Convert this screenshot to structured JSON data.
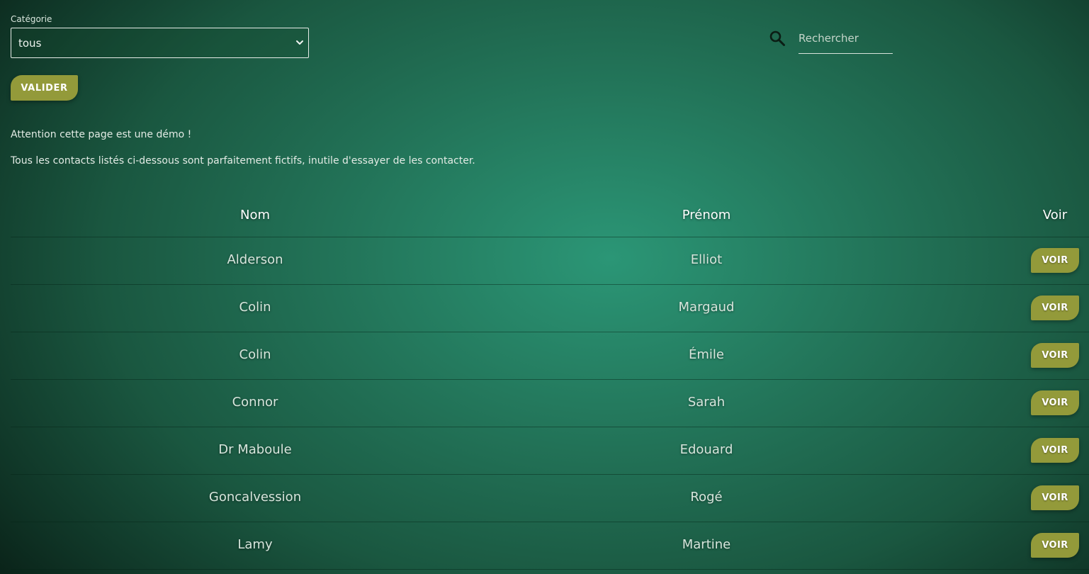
{
  "filter": {
    "category_label": "Catégorie",
    "category_selected": "tous",
    "submit_label": "VALIDER"
  },
  "search": {
    "placeholder": "Rechercher",
    "icon": "search-icon"
  },
  "notice": {
    "line1": "Attention cette page est une démo !",
    "line2": "Tous les contacts listés ci-dessous sont parfaitement fictifs, inutile d'essayer de les contacter."
  },
  "table": {
    "headers": [
      "Nom",
      "Prénom",
      "Voir"
    ],
    "action_label": "VOIR",
    "rows": [
      {
        "nom": "Alderson",
        "prenom": "Elliot"
      },
      {
        "nom": "Colin",
        "prenom": "Margaud"
      },
      {
        "nom": "Colin",
        "prenom": "Émile"
      },
      {
        "nom": "Connor",
        "prenom": "Sarah"
      },
      {
        "nom": "Dr Maboule",
        "prenom": "Edouard"
      },
      {
        "nom": "Goncalvession",
        "prenom": "Rogé"
      },
      {
        "nom": "Lamy",
        "prenom": "Martine"
      }
    ]
  },
  "colors": {
    "accent_button": "#939a3a",
    "background_center": "#2b9676",
    "background_edge": "#071a12"
  }
}
